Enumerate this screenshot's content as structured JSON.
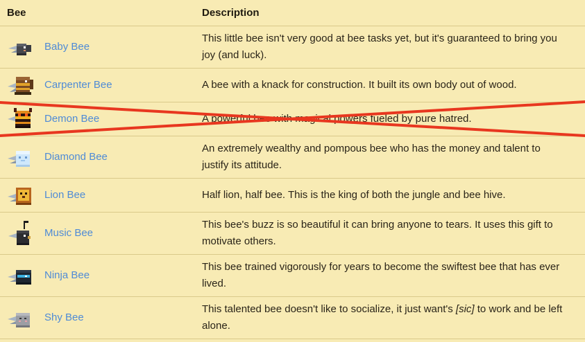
{
  "header": {
    "bee_col": "Bee",
    "desc_col": "Description"
  },
  "rows": [
    {
      "name": "Baby Bee",
      "icon": "baby-bee-icon",
      "desc": "This little bee isn't very good at bee tasks yet, but it's guaranteed to bring you joy (and luck)."
    },
    {
      "name": "Carpenter Bee",
      "icon": "carpenter-bee-icon",
      "desc": "A bee with a knack for construction. It built its own body out of wood."
    },
    {
      "name": "Demon Bee",
      "icon": "demon-bee-icon",
      "desc": "A powerful bee with magical powers fueled by pure hatred.",
      "crossed_out": true
    },
    {
      "name": "Diamond Bee",
      "icon": "diamond-bee-icon",
      "desc": "An extremely wealthy and pompous bee who has the money and talent to justify its attitude."
    },
    {
      "name": "Lion Bee",
      "icon": "lion-bee-icon",
      "desc": "Half lion, half bee. This is the king of both the jungle and bee hive."
    },
    {
      "name": "Music Bee",
      "icon": "music-bee-icon",
      "desc": "This bee's buzz is so beautiful it can bring anyone to tears. It uses this gift to motivate others."
    },
    {
      "name": "Ninja Bee",
      "icon": "ninja-bee-icon",
      "desc": "This bee trained vigorously for years to become the swiftest bee that has ever lived."
    },
    {
      "name": "Shy Bee",
      "icon": "shy-bee-icon",
      "desc_before": "This talented bee doesn't like to socialize, it just want's ",
      "desc_sic": "[sic]",
      "desc_after": " to work and be left alone."
    }
  ],
  "colors": {
    "background": "#f8ebb4",
    "link": "#4f8bd6",
    "strike": "#e8371f",
    "border": "#d9c98a"
  }
}
